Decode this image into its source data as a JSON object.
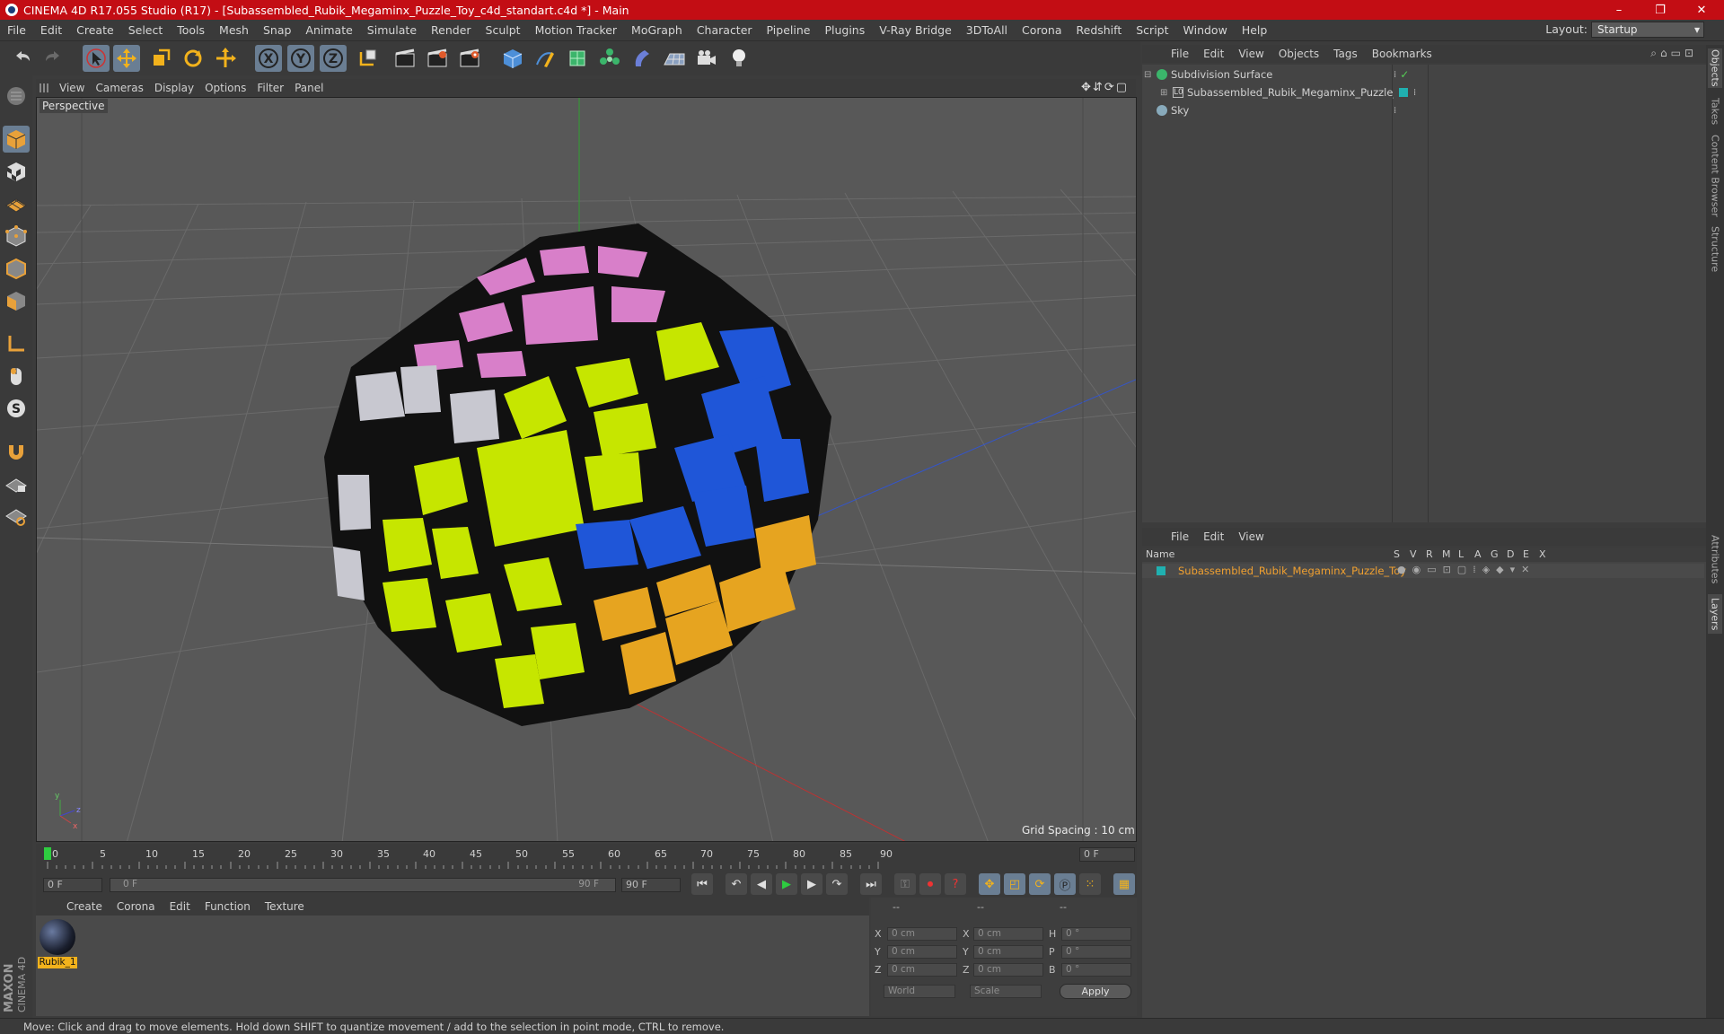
{
  "window": {
    "title": "CINEMA 4D R17.055 Studio (R17) - [Subassembled_Rubik_Megaminx_Puzzle_Toy_c4d_standart.c4d *] - Main",
    "minimize": "–",
    "restore": "❐",
    "close": "✕"
  },
  "menubar": {
    "items": [
      "File",
      "Edit",
      "Create",
      "Select",
      "Tools",
      "Mesh",
      "Snap",
      "Animate",
      "Simulate",
      "Render",
      "Sculpt",
      "Motion Tracker",
      "MoGraph",
      "Character",
      "Pipeline",
      "Plugins",
      "V-Ray Bridge",
      "3DToAll",
      "Corona",
      "Redshift",
      "Script",
      "Window",
      "Help"
    ],
    "layout_label": "Layout:",
    "layout_value": "Startup"
  },
  "viewport": {
    "menu": [
      "View",
      "Cameras",
      "Display",
      "Options",
      "Filter",
      "Panel"
    ],
    "label": "Perspective",
    "grid_spacing": "Grid Spacing : 10 cm",
    "axes": {
      "y": "y",
      "z": "z",
      "x": "x"
    }
  },
  "timeline": {
    "ticks": [
      "0",
      "5",
      "10",
      "15",
      "20",
      "25",
      "30",
      "35",
      "40",
      "45",
      "50",
      "55",
      "60",
      "65",
      "70",
      "75",
      "80",
      "85",
      "90"
    ],
    "current_frame": "0 F",
    "start_field": "0 F",
    "range_start": "0 F",
    "range_end": "90 F",
    "end_field": "90 F"
  },
  "material_manager": {
    "menu": [
      "Create",
      "Corona",
      "Edit",
      "Function",
      "Texture"
    ],
    "materials": [
      {
        "name": "Rubik_1"
      }
    ]
  },
  "coordinates": {
    "headers": [
      "--",
      "--",
      "--"
    ],
    "rows": [
      {
        "axis1": "X",
        "pos": "0 cm",
        "axis2": "X",
        "size": "0 cm",
        "axis3": "H",
        "rot": "0 °"
      },
      {
        "axis1": "Y",
        "pos": "0 cm",
        "axis2": "Y",
        "size": "0 cm",
        "axis3": "P",
        "rot": "0 °"
      },
      {
        "axis1": "Z",
        "pos": "0 cm",
        "axis2": "Z",
        "size": "0 cm",
        "axis3": "B",
        "rot": "0 °"
      }
    ],
    "mode1": "World",
    "mode2": "Scale",
    "apply": "Apply"
  },
  "object_manager": {
    "menu": [
      "File",
      "Edit",
      "View",
      "Objects",
      "Tags",
      "Bookmarks"
    ],
    "objects": [
      {
        "name": "Subdivision Surface"
      },
      {
        "name": "Subassembled_Rubik_Megaminx_Puzzle_Toy"
      },
      {
        "name": "Sky"
      }
    ]
  },
  "layer_manager": {
    "menu": [
      "File",
      "Edit",
      "View"
    ],
    "columns": [
      "Name",
      "S",
      "V",
      "R",
      "M",
      "L",
      "A",
      "G",
      "D",
      "E",
      "X"
    ],
    "layers": [
      {
        "name": "Subassembled_Rubik_Megaminx_Puzzle_Toy",
        "color": "#f0a030"
      }
    ]
  },
  "side_tabs": [
    "Objects",
    "Takes",
    "Content Browser",
    "Structure",
    "Attributes",
    "Layers"
  ],
  "status": "Move: Click and drag to move elements. Hold down SHIFT to quantize movement / add to the selection in point mode, CTRL to remove.",
  "brand": {
    "line1": "MAXON",
    "line2": "CINEMA 4D"
  },
  "colors": {
    "accent": "#c30d14",
    "highlight": "#6a7e93",
    "layer_text": "#f0a030"
  }
}
